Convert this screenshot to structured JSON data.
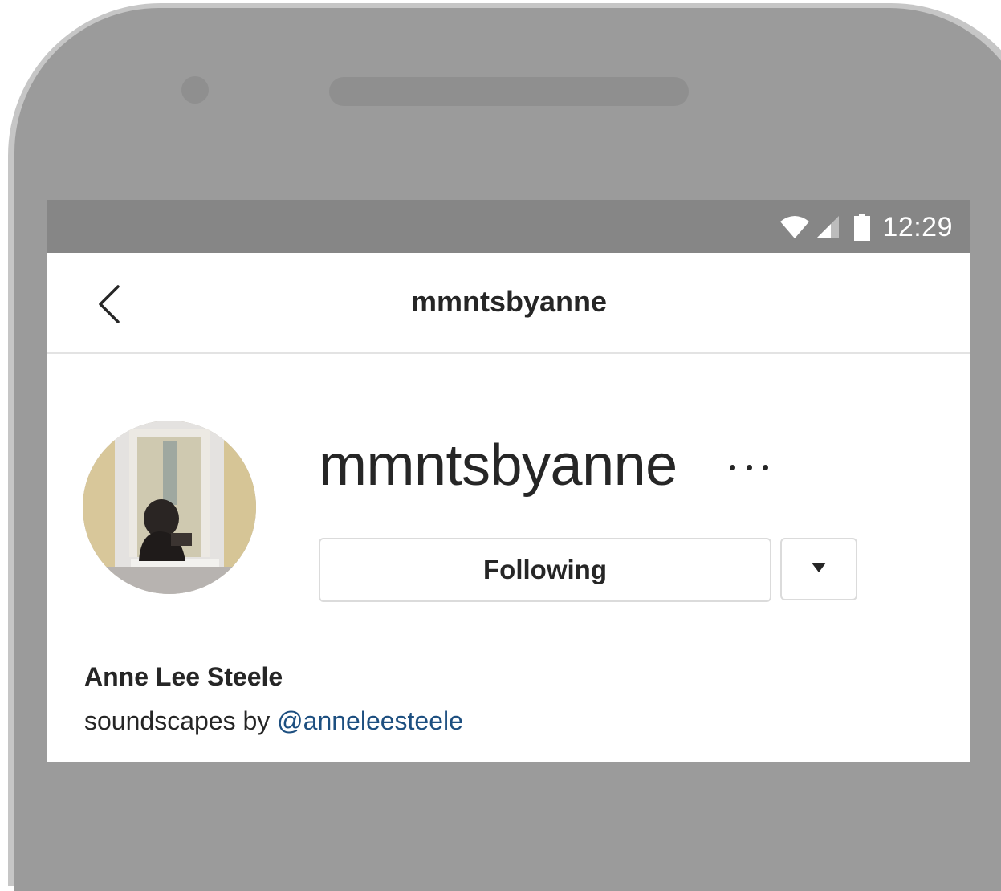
{
  "status_bar": {
    "time": "12:29",
    "icons": [
      "wifi-icon",
      "signal-icon",
      "battery-icon"
    ]
  },
  "nav": {
    "title": "mmntsbyanne",
    "back_icon": "chevron-left-icon"
  },
  "profile": {
    "username": "mmntsbyanne",
    "more_icon": "more-horizontal-icon",
    "following_label": "Following",
    "dropdown_icon": "triangle-down-icon",
    "full_name": "Anne Lee Steele",
    "bio_prefix": "soundscapes by",
    "bio_mention": "@anneleesteele"
  },
  "colors": {
    "device_frame": "#9b9b9b",
    "status_bar": "#868686",
    "text_primary": "#262626",
    "link": "#1d4f80",
    "border": "#dbdbdb"
  }
}
